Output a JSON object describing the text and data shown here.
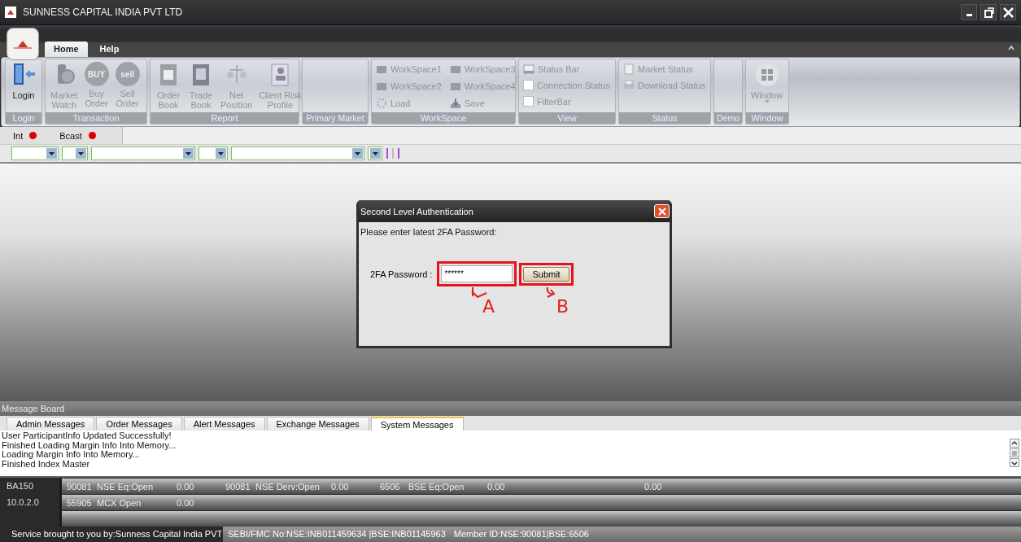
{
  "window": {
    "title": "SUNNESS CAPITAL INDIA PVT LTD"
  },
  "ribbon": {
    "tabs": [
      {
        "label": "Home",
        "selected": true
      },
      {
        "label": "Help",
        "selected": false
      }
    ],
    "groups": [
      {
        "label": "Login",
        "items": [
          {
            "kind": "large",
            "label": "Login",
            "disabled": false
          }
        ]
      },
      {
        "label": "Transaction",
        "items": [
          {
            "kind": "large",
            "label": "Market\nWatch",
            "disabled": true
          },
          {
            "kind": "large",
            "label": "Buy\nOrder",
            "disabled": true,
            "logo_text": "BUY"
          },
          {
            "kind": "large",
            "label": "Sell\nOrder",
            "disabled": true,
            "logo_text": "sell"
          }
        ]
      },
      {
        "label": "Report",
        "items": [
          {
            "kind": "large",
            "label": "Order\nBook",
            "disabled": true
          },
          {
            "kind": "large",
            "label": "Trade\nBook",
            "disabled": true
          },
          {
            "kind": "large",
            "label": "Net\nPosition",
            "disabled": true
          },
          {
            "kind": "large",
            "label": "Client Risk\nProfile",
            "disabled": true
          }
        ]
      },
      {
        "label": "Primary Market"
      },
      {
        "label": "WorkSpace",
        "items": [
          {
            "kind": "small",
            "label": "WorkSpace1",
            "disabled": true
          },
          {
            "kind": "small",
            "label": "WorkSpace2",
            "disabled": true
          },
          {
            "kind": "small",
            "label": "Load",
            "disabled": true
          },
          {
            "kind": "small",
            "label": "WorkSpace3",
            "disabled": true
          },
          {
            "kind": "small",
            "label": "WorkSpace4",
            "disabled": true
          },
          {
            "kind": "small",
            "label": "Save",
            "disabled": true
          }
        ]
      },
      {
        "label": "View",
        "items": [
          {
            "kind": "small",
            "label": "Status Bar",
            "disabled": true
          },
          {
            "kind": "checkbox",
            "label": "Connection Status",
            "checked": false,
            "disabled": true
          },
          {
            "kind": "checkbox",
            "label": "FilterBar",
            "checked": false,
            "disabled": true
          }
        ]
      },
      {
        "label": "Status",
        "items": [
          {
            "kind": "small",
            "label": "Market Status",
            "disabled": true
          },
          {
            "kind": "small",
            "label": "Download Status",
            "disabled": true
          }
        ]
      },
      {
        "label": "Demo"
      },
      {
        "label": "Window",
        "items": [
          {
            "kind": "large",
            "label": "Window",
            "disabled": true,
            "dropdown": true
          }
        ]
      }
    ]
  },
  "indicators": [
    {
      "label": "Int",
      "connected": false
    },
    {
      "label": "Bcast",
      "connected": false
    }
  ],
  "dialog": {
    "title": "Second Level Authentication",
    "prompt": "Please enter latest 2FA Password:",
    "field_label": "2FA Password :",
    "field_value": "******",
    "button": "Submit",
    "annotations": [
      "A",
      "B"
    ]
  },
  "message_board": {
    "title": "Message Board",
    "tabs": [
      {
        "label": "Admin Messages",
        "selected": false
      },
      {
        "label": "Order Messages",
        "selected": false
      },
      {
        "label": "Alert Messages",
        "selected": false
      },
      {
        "label": "Exchange Messages",
        "selected": false
      },
      {
        "label": "System  Messages",
        "selected": true
      }
    ],
    "messages": [
      "User ParticipantInfo Updated Successfully!",
      "Finished Loading Margin Info Into Memory...",
      "Loading Margin Info Into Memory...",
      "Finished Index Master"
    ]
  },
  "market_rows": [
    {
      "label": "BA150",
      "cells": [
        "90081",
        "NSE Eq:Open",
        "0.00",
        "90081",
        "NSE Derv:Open",
        "0.00",
        "6506",
        "BSE Eq:Open",
        "0.00",
        "0.00"
      ]
    },
    {
      "label": "10.0.2.0",
      "cells": [
        "55905",
        "MCX Open",
        "0.00"
      ]
    },
    {}
  ],
  "status_bar": [
    "Service brought to you by:Sunness Capital India PVT",
    "SEBI/FMC No:NSE:INB011459634 |BSE:INB01145963",
    "Member ID:NSE:90081|BSE:6506"
  ]
}
